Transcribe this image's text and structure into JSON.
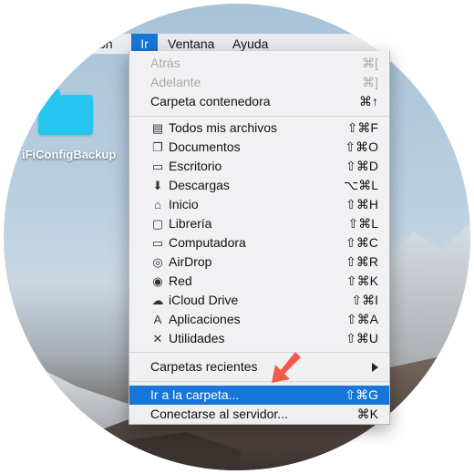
{
  "menubar": {
    "partial_item": "ón",
    "ir": "Ir",
    "ventana": "Ventana",
    "ayuda": "Ayuda"
  },
  "desktop": {
    "folder_label": "iFiConfigBackup"
  },
  "menu": {
    "top_items": [
      {
        "label": "Atrás",
        "shortcut": "⌘[",
        "disabled": true
      },
      {
        "label": "Adelante",
        "shortcut": "⌘]",
        "disabled": true
      },
      {
        "label": "Carpeta contenedora",
        "shortcut": "⌘↑",
        "disabled": false
      }
    ],
    "places": [
      {
        "label": "Todos mis archivos",
        "shortcut": "⇧⌘F",
        "icon": "all-files-icon"
      },
      {
        "label": "Documentos",
        "shortcut": "⇧⌘O",
        "icon": "documents-icon"
      },
      {
        "label": "Escritorio",
        "shortcut": "⇧⌘D",
        "icon": "desktop-icon"
      },
      {
        "label": "Descargas",
        "shortcut": "⌥⌘L",
        "icon": "downloads-icon"
      },
      {
        "label": "Inicio",
        "shortcut": "⇧⌘H",
        "icon": "home-icon"
      },
      {
        "label": "Librería",
        "shortcut": "⇧⌘L",
        "icon": "library-folder-icon"
      },
      {
        "label": "Computadora",
        "shortcut": "⇧⌘C",
        "icon": "computer-icon"
      },
      {
        "label": "AirDrop",
        "shortcut": "⇧⌘R",
        "icon": "airdrop-icon"
      },
      {
        "label": "Red",
        "shortcut": "⇧⌘K",
        "icon": "network-icon"
      },
      {
        "label": "iCloud Drive",
        "shortcut": "⇧⌘I",
        "icon": "cloud-icon"
      },
      {
        "label": "Aplicaciones",
        "shortcut": "⇧⌘A",
        "icon": "applications-icon"
      },
      {
        "label": "Utilidades",
        "shortcut": "⇧⌘U",
        "icon": "utilities-icon"
      }
    ],
    "recent": {
      "label": "Carpetas recientes"
    },
    "go_to_folder": {
      "label": "Ir a la carpeta...",
      "shortcut": "⇧⌘G",
      "highlighted": true
    },
    "connect_server": {
      "label": "Conectarse al servidor...",
      "shortcut": "⌘K"
    }
  },
  "colors": {
    "highlight": "#1677d9",
    "arrow": "#f15a4a",
    "folder": "#27c6f0"
  }
}
